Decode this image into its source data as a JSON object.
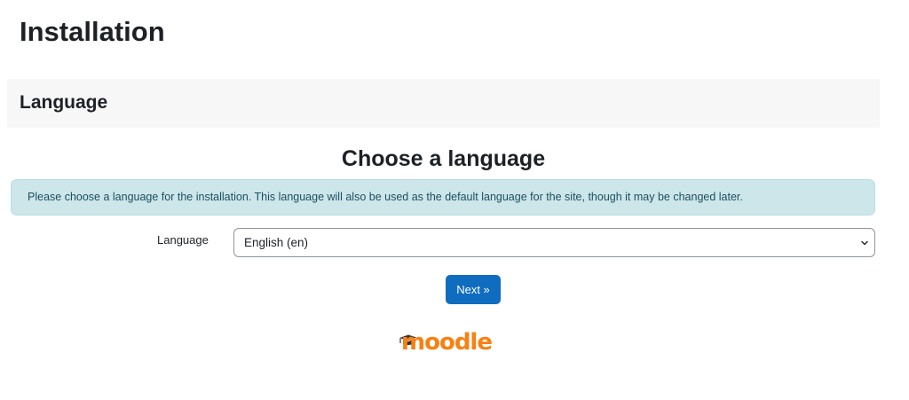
{
  "page": {
    "title": "Installation"
  },
  "section": {
    "title": "Language"
  },
  "main": {
    "heading": "Choose a language",
    "info_message": "Please choose a language for the installation. This language will also be used as the default language for the site, though it may be changed later.",
    "language_field": {
      "label": "Language",
      "selected_value": "English (en)"
    },
    "next_button_label": "Next »"
  },
  "logo": {
    "text": "moodle",
    "icon": "graduation-cap-icon"
  },
  "colors": {
    "primary": "#0f6cbf",
    "info_background": "#cce6ea",
    "brand_orange": "#f98012"
  }
}
